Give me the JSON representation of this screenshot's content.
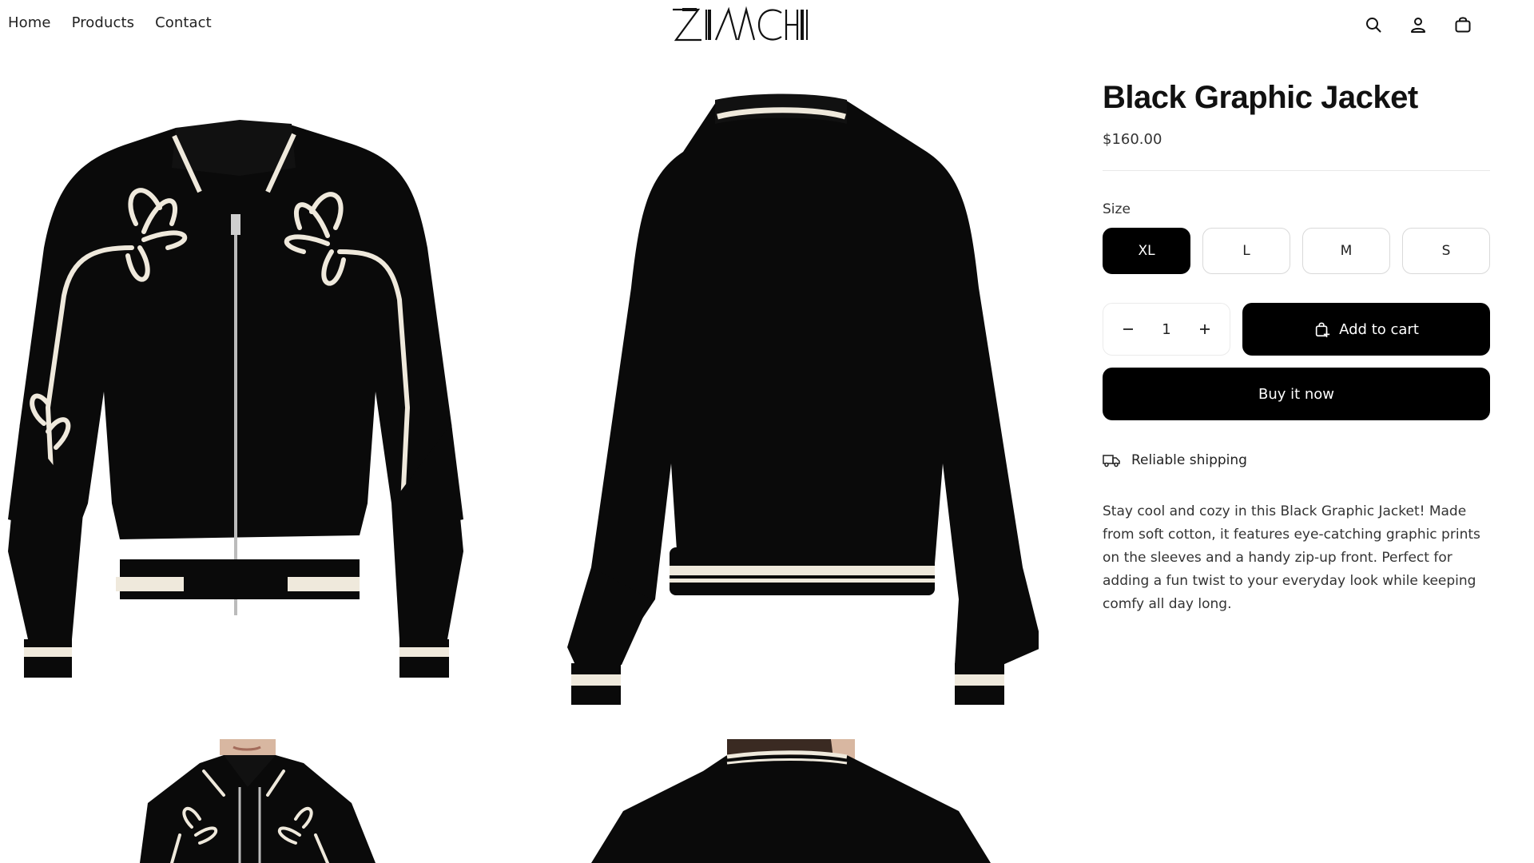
{
  "header": {
    "nav": [
      {
        "label": "Home"
      },
      {
        "label": "Products"
      },
      {
        "label": "Contact"
      }
    ],
    "logo_text": "ZENACHI",
    "icons": [
      "search-icon",
      "account-icon",
      "cart-icon"
    ]
  },
  "gallery": {
    "images": [
      "jacket-front",
      "jacket-back",
      "model-front",
      "model-back"
    ]
  },
  "product": {
    "title": "Black Graphic Jacket",
    "price": "$160.00",
    "size_label": "Size",
    "sizes": [
      "XL",
      "L",
      "M",
      "S"
    ],
    "selected_size": "XL",
    "quantity": "1",
    "add_to_cart_label": "Add to cart",
    "buy_now_label": "Buy it now",
    "shipping_label": "Reliable shipping",
    "description": "Stay cool and cozy in this Black Graphic Jacket! Made from soft cotton, it features eye-catching graphic prints on the sleeves and a handy zip-up front. Perfect for adding a fun twist to your everyday look while keeping comfy all day long."
  },
  "colors": {
    "primary": "#000000",
    "background": "#ffffff",
    "text": "#121212",
    "cream_trim": "#efe9dc"
  }
}
